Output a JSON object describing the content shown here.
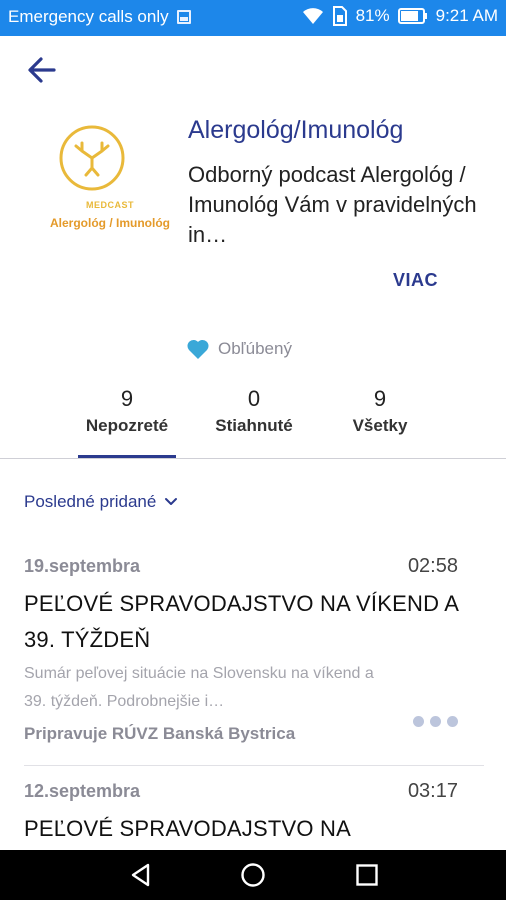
{
  "status_bar": {
    "carrier": "Emergency calls only",
    "battery": "81%",
    "time": "9:21 AM"
  },
  "header": {
    "back_icon": "arrow-left-icon"
  },
  "podcast": {
    "logo_title": "MEDCAST",
    "logo_subtitle": "Alergológ / Imunológ",
    "title": "Alergológ/Imunológ",
    "description": "Odborný podcast Alergológ / Imunológ Vám v pravidelných in…",
    "more_label": "VIAC",
    "favorite_label": "Obľúbený",
    "accent_color": "#2b3a8e",
    "favorite_color": "#3aa8d8",
    "logo_color": "#e9b93a"
  },
  "tabs": [
    {
      "count": "9",
      "label": "Nepozreté",
      "active": true
    },
    {
      "count": "0",
      "label": "Stiahnuté",
      "active": false
    },
    {
      "count": "9",
      "label": "Všetky",
      "active": false
    }
  ],
  "sort": {
    "label": "Posledné pridané"
  },
  "episodes": [
    {
      "date": "19.septembra",
      "duration": "02:58",
      "title": "PEĽOVÉ SPRAVODAJSTVO NA VÍKEND A 39. TÝŽDEŇ",
      "description": "Sumár peľovej situácie na Slovensku na víkend a 39. týždeň. Podrobnejšie i…",
      "author": "Pripravuje RÚVZ Banská Bystrica"
    },
    {
      "date": "12.septembra",
      "duration": "03:17",
      "title": "PEĽOVÉ SPRAVODAJSTVO NA"
    }
  ]
}
